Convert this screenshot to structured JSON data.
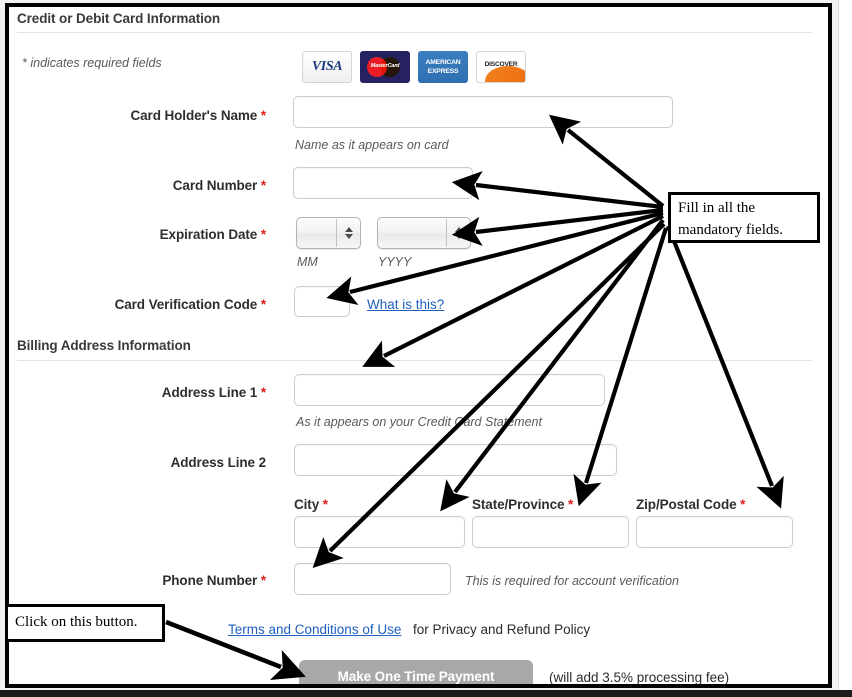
{
  "sections": {
    "card": {
      "title": "Credit or Debit Card Information"
    },
    "billing": {
      "title": "Billing Address Information"
    }
  },
  "required_note": "* indicates required fields",
  "card_logos": [
    {
      "name": "visa-logo",
      "text": "VISA"
    },
    {
      "name": "mastercard-logo",
      "text": "MasterCard"
    },
    {
      "name": "amex-logo",
      "line1": "AMERICAN",
      "line2": "EXPRESS"
    },
    {
      "name": "discover-logo",
      "text": "DISCOVER"
    }
  ],
  "fields": {
    "card_holder": {
      "label": "Card Holder's Name",
      "required": "*",
      "value": "",
      "hint": "Name as it appears on card"
    },
    "card_number": {
      "label": "Card Number",
      "required": "*",
      "value": ""
    },
    "expiration": {
      "label": "Expiration Date",
      "required": "*",
      "month_value": "",
      "year_value": "",
      "month_hint": "MM",
      "year_hint": "YYYY"
    },
    "cvc": {
      "label": "Card Verification Code",
      "required": "*",
      "value": "",
      "help_link": "What is this?"
    },
    "address1": {
      "label": "Address Line 1",
      "required": "*",
      "value": "",
      "hint": "As it appears on your Credit Card Statement"
    },
    "address2": {
      "label": "Address Line 2",
      "required": "",
      "value": ""
    },
    "city": {
      "label": "City",
      "required": "*",
      "value": ""
    },
    "state": {
      "label": "State/Province",
      "required": "*",
      "value": ""
    },
    "zip": {
      "label": "Zip/Postal Code",
      "required": "*",
      "value": ""
    },
    "phone": {
      "label": "Phone Number",
      "required": "*",
      "value": "",
      "hint": "This is required for account verification"
    }
  },
  "terms": {
    "link_text": "Terms and Conditions of Use",
    "suffix_text": " for Privacy and Refund Policy"
  },
  "submit": {
    "label": "Make One Time Payment",
    "note": "(will add 3.5% processing fee)"
  },
  "annotations": {
    "mandatory": "Fill in all the mandatory fields.",
    "button": "Click on this button."
  },
  "colors": {
    "required_star": "#e01b1b",
    "link": "#1f5fbf",
    "button_bg": "#a8a8a8",
    "annotation_border": "#000000"
  }
}
